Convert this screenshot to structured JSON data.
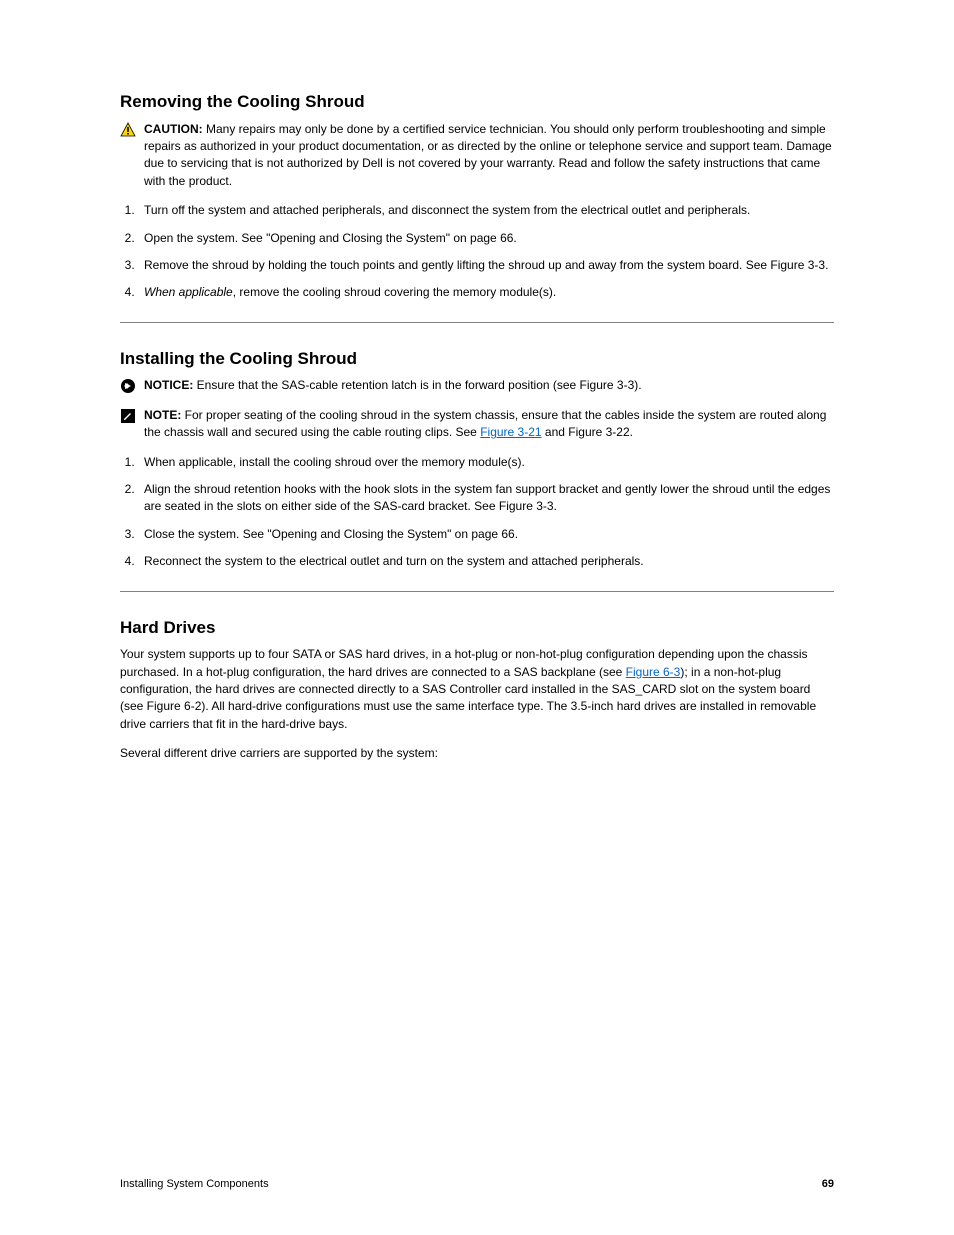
{
  "sectionA": {
    "heading": "Removing the Cooling Shroud",
    "caution_lead": "CAUTION: ",
    "caution_text": "Many repairs may only be done by a certified service technician. You should only perform troubleshooting and simple repairs as authorized in your product documentation, or as directed by the online or telephone service and support team. Damage due to servicing that is not authorized by Dell is not covered by your warranty. Read and follow the safety instructions that came with the product.",
    "step1": "Turn off the system and attached peripherals, and disconnect the system from the electrical outlet and peripherals.",
    "step2": "Open the system. See \"Opening and Closing the System\" on page 66.",
    "step3": "Remove the shroud by holding the touch points and gently lifting the shroud up and away from the system board. See Figure 3-3.",
    "step4a": "When applicable",
    "step4b": ", remove the cooling shroud covering the memory module(s)."
  },
  "sectionB": {
    "heading": "Installing the Cooling Shroud",
    "notice_lead": "NOTICE: ",
    "notice_text": "Ensure that the SAS-cable retention latch is in the forward position (see Figure 3-3).",
    "note_lead": "NOTE: ",
    "note_text_pre": "For proper seating of the cooling shroud in the system chassis, ensure that the cables inside the system are routed along the chassis wall and secured using the cable routing clips. See ",
    "note_link": "Figure 3-21",
    "note_text_post": " and Figure 3-22.",
    "step1": "When applicable, install the cooling shroud over the memory module(s).",
    "step2": "Align the shroud retention hooks with the hook slots in the system fan support bracket and gently lower the shroud until the edges are seated in the slots on either side of the SAS-card bracket. See Figure 3-3.",
    "step3": "Close the system. See \"Opening and Closing the System\" on page 66.",
    "step4": "Reconnect the system to the electrical outlet and turn on the system and attached peripherals."
  },
  "sectionC": {
    "heading": "Hard Drives",
    "para1_pre": "Your system supports up to four SATA or SAS hard drives, in a hot-plug or non-hot-plug configuration depending upon the chassis purchased. In a hot-plug configuration, the hard drives are connected to a SAS backplane (see ",
    "para1_link": "Figure 6-3",
    "para1_post": "); in a non-hot-plug configuration, the hard drives are connected directly to a SAS Controller card installed in the SAS_CARD slot on the system board (see Figure 6-2). All hard-drive configurations must use the same interface type. The 3.5-inch hard drives are installed in removable drive carriers that fit in the hard-drive bays.",
    "para2": "Several different drive carriers are supported by the system:"
  },
  "footer": {
    "left": "Installing System Components",
    "right": "69"
  }
}
